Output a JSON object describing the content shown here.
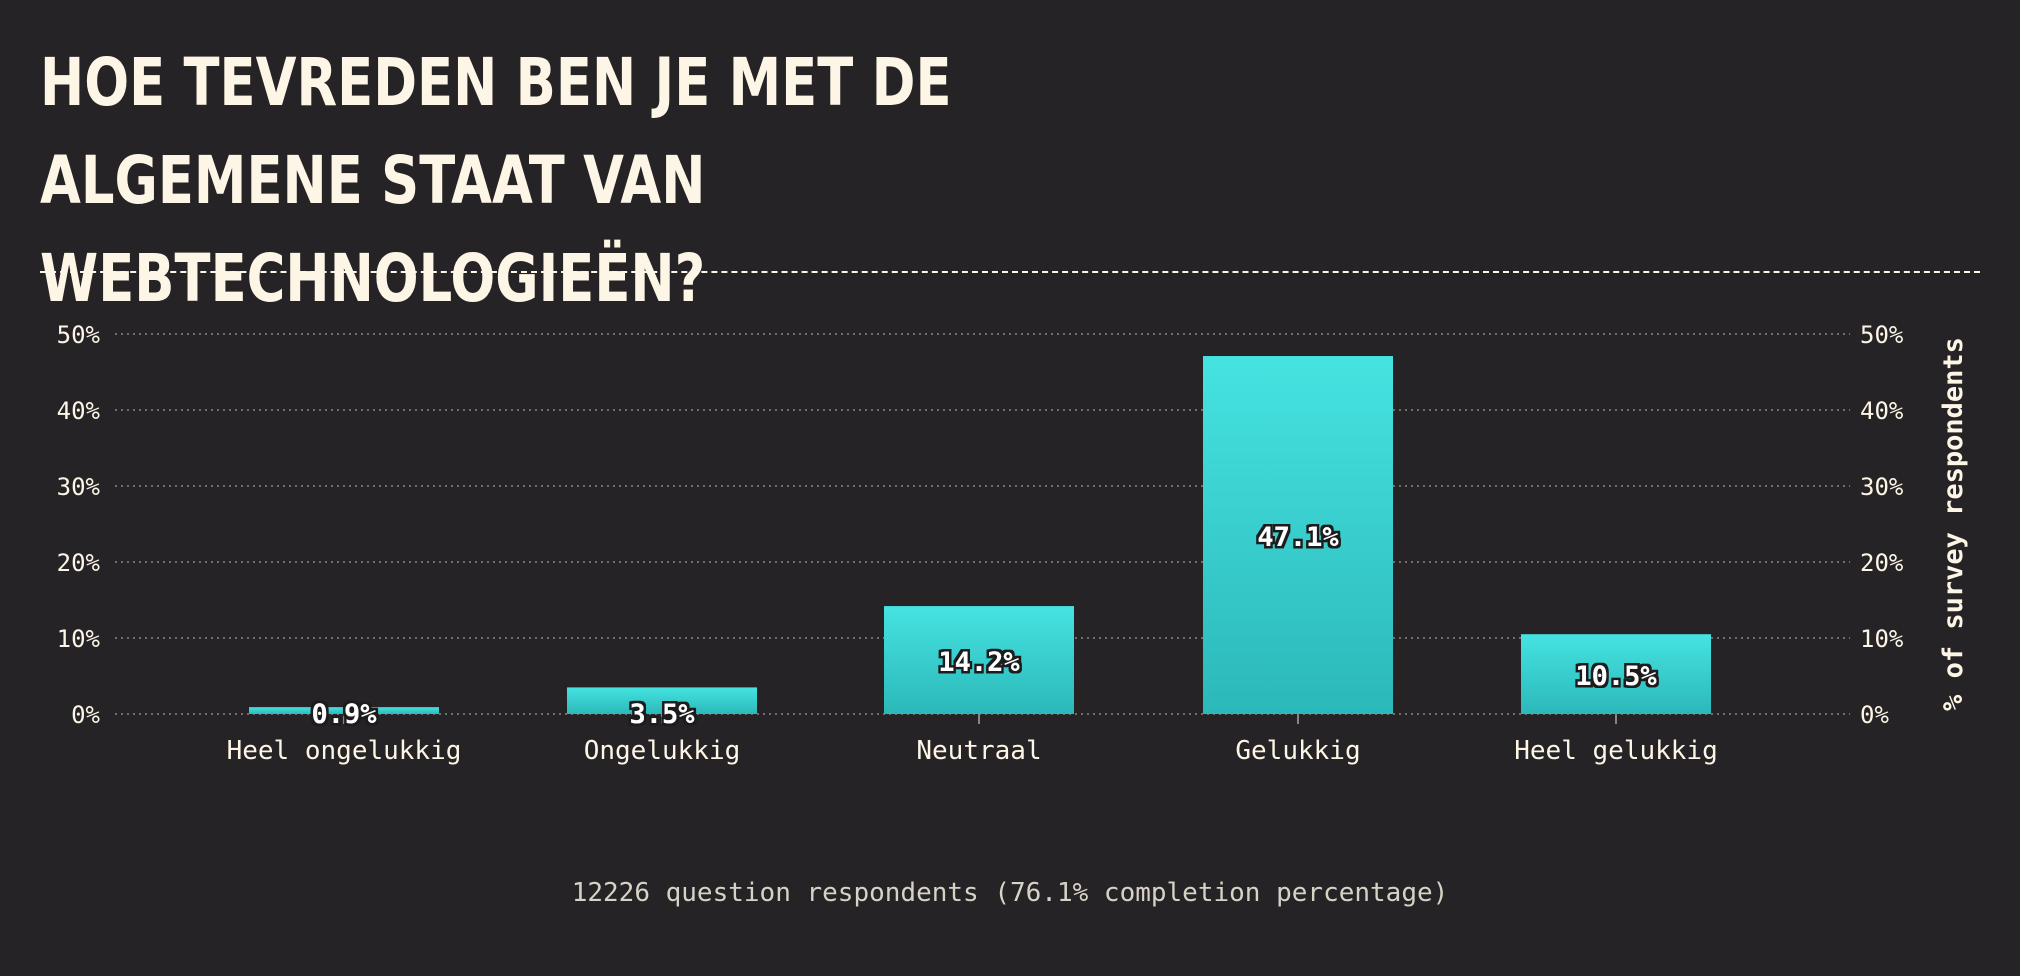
{
  "title": "HOE TEVREDEN BEN JE MET DE ALGEMENE STAAT VAN WEBTECHNOLOGIEËN?",
  "footer": "12226 question respondents (76.1% completion percentage)",
  "colors": {
    "background": "#252325",
    "bar_top": "#45e3e1",
    "bar_bottom": "#2cb8b9",
    "text": "#fdf6e6",
    "grid": "#8a8580"
  },
  "chart_data": {
    "type": "bar",
    "categories": [
      "Heel ongelukkig",
      "Ongelukkig",
      "Neutraal",
      "Gelukkig",
      "Heel gelukkig"
    ],
    "values": [
      0.9,
      3.5,
      14.2,
      47.1,
      10.5
    ],
    "value_labels": [
      "0.9%",
      "3.5%",
      "14.2%",
      "47.1%",
      "10.5%"
    ],
    "ylabel": "% of survey respondents",
    "ylim": [
      0,
      50
    ],
    "yticks": [
      "0%",
      "10%",
      "20%",
      "30%",
      "40%",
      "50%"
    ],
    "ytick_values": [
      0,
      10,
      20,
      30,
      40,
      50
    ],
    "grid": true,
    "y_axis_both_sides": true
  }
}
